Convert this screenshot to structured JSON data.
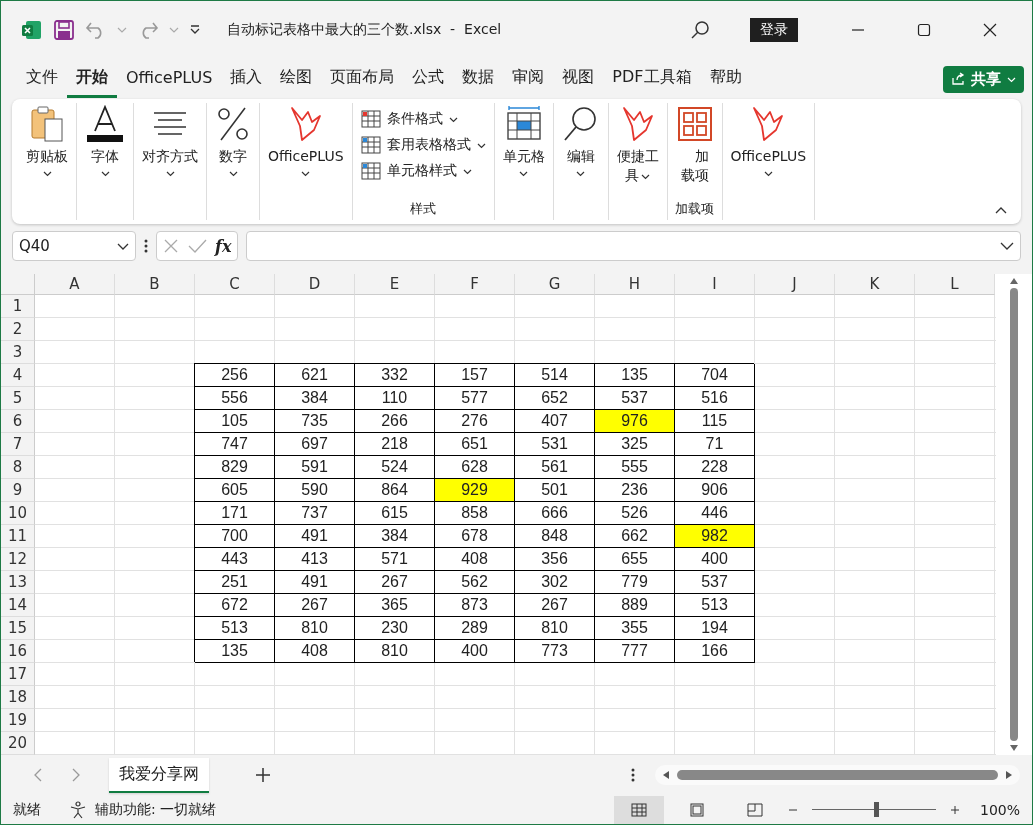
{
  "window": {
    "title": "自动标记表格中最大的三个数.xlsx  -  Excel",
    "sign_in": "登录"
  },
  "menu_tabs": [
    {
      "label": "文件",
      "selected": false
    },
    {
      "label": "开始",
      "selected": true
    },
    {
      "label": "OfficePLUS",
      "selected": false
    },
    {
      "label": "插入",
      "selected": false
    },
    {
      "label": "绘图",
      "selected": false
    },
    {
      "label": "页面布局",
      "selected": false
    },
    {
      "label": "公式",
      "selected": false
    },
    {
      "label": "数据",
      "selected": false
    },
    {
      "label": "审阅",
      "selected": false
    },
    {
      "label": "视图",
      "selected": false
    },
    {
      "label": "PDF工具箱",
      "selected": false
    },
    {
      "label": "帮助",
      "selected": false
    }
  ],
  "share_button": "共享",
  "ribbon": [
    {
      "kind": "large",
      "label": "剪贴板"
    },
    {
      "kind": "large",
      "label": "字体"
    },
    {
      "kind": "large",
      "label": "对齐方式"
    },
    {
      "kind": "large",
      "label": "数字"
    },
    {
      "kind": "large",
      "label": "OfficePLUS"
    },
    {
      "kind": "stack",
      "items": [
        "条件格式",
        "套用表格格式",
        "单元格样式"
      ],
      "group_label": "样式"
    },
    {
      "kind": "large",
      "label": "单元格"
    },
    {
      "kind": "large",
      "label": "编辑"
    },
    {
      "kind": "large",
      "label": "便捷工具"
    },
    {
      "kind": "addin",
      "label": "加载项",
      "group_label": "加载项"
    },
    {
      "kind": "large",
      "label": "OfficePLUS"
    }
  ],
  "formula_bar": {
    "name_box": "Q40",
    "fx": "fx"
  },
  "sheet": {
    "columns": [
      "A",
      "B",
      "C",
      "D",
      "E",
      "F",
      "G",
      "H",
      "I",
      "J",
      "K",
      "L"
    ],
    "rows": [
      {
        "header": "1"
      },
      {
        "header": "2"
      },
      {
        "header": "3"
      },
      {
        "header": "4",
        "values": [
          {
            "text": "256",
            "highlighted": false
          },
          {
            "text": "621",
            "highlighted": false
          },
          {
            "text": "332",
            "highlighted": false
          },
          {
            "text": "157",
            "highlighted": false
          },
          {
            "text": "514",
            "highlighted": false
          },
          {
            "text": "135",
            "highlighted": false
          },
          {
            "text": "704",
            "highlighted": false
          }
        ]
      },
      {
        "header": "5",
        "values": [
          {
            "text": "556",
            "highlighted": false
          },
          {
            "text": "384",
            "highlighted": false
          },
          {
            "text": "110",
            "highlighted": false
          },
          {
            "text": "577",
            "highlighted": false
          },
          {
            "text": "652",
            "highlighted": false
          },
          {
            "text": "537",
            "highlighted": false
          },
          {
            "text": "516",
            "highlighted": false
          }
        ]
      },
      {
        "header": "6",
        "values": [
          {
            "text": "105",
            "highlighted": false
          },
          {
            "text": "735",
            "highlighted": false
          },
          {
            "text": "266",
            "highlighted": false
          },
          {
            "text": "276",
            "highlighted": false
          },
          {
            "text": "407",
            "highlighted": false
          },
          {
            "text": "976",
            "highlighted": true
          },
          {
            "text": "115",
            "highlighted": false
          }
        ]
      },
      {
        "header": "7",
        "values": [
          {
            "text": "747",
            "highlighted": false
          },
          {
            "text": "697",
            "highlighted": false
          },
          {
            "text": "218",
            "highlighted": false
          },
          {
            "text": "651",
            "highlighted": false
          },
          {
            "text": "531",
            "highlighted": false
          },
          {
            "text": "325",
            "highlighted": false
          },
          {
            "text": "71",
            "highlighted": false
          }
        ]
      },
      {
        "header": "8",
        "values": [
          {
            "text": "829",
            "highlighted": false
          },
          {
            "text": "591",
            "highlighted": false
          },
          {
            "text": "524",
            "highlighted": false
          },
          {
            "text": "628",
            "highlighted": false
          },
          {
            "text": "561",
            "highlighted": false
          },
          {
            "text": "555",
            "highlighted": false
          },
          {
            "text": "228",
            "highlighted": false
          }
        ]
      },
      {
        "header": "9",
        "values": [
          {
            "text": "605",
            "highlighted": false
          },
          {
            "text": "590",
            "highlighted": false
          },
          {
            "text": "864",
            "highlighted": false
          },
          {
            "text": "929",
            "highlighted": true
          },
          {
            "text": "501",
            "highlighted": false
          },
          {
            "text": "236",
            "highlighted": false
          },
          {
            "text": "906",
            "highlighted": false
          }
        ]
      },
      {
        "header": "10",
        "values": [
          {
            "text": "171",
            "highlighted": false
          },
          {
            "text": "737",
            "highlighted": false
          },
          {
            "text": "615",
            "highlighted": false
          },
          {
            "text": "858",
            "highlighted": false
          },
          {
            "text": "666",
            "highlighted": false
          },
          {
            "text": "526",
            "highlighted": false
          },
          {
            "text": "446",
            "highlighted": false
          }
        ]
      },
      {
        "header": "11",
        "values": [
          {
            "text": "700",
            "highlighted": false
          },
          {
            "text": "491",
            "highlighted": false
          },
          {
            "text": "384",
            "highlighted": false
          },
          {
            "text": "678",
            "highlighted": false
          },
          {
            "text": "848",
            "highlighted": false
          },
          {
            "text": "662",
            "highlighted": false
          },
          {
            "text": "982",
            "highlighted": true
          }
        ]
      },
      {
        "header": "12",
        "values": [
          {
            "text": "443",
            "highlighted": false
          },
          {
            "text": "413",
            "highlighted": false
          },
          {
            "text": "571",
            "highlighted": false
          },
          {
            "text": "408",
            "highlighted": false
          },
          {
            "text": "356",
            "highlighted": false
          },
          {
            "text": "655",
            "highlighted": false
          },
          {
            "text": "400",
            "highlighted": false
          }
        ]
      },
      {
        "header": "13",
        "values": [
          {
            "text": "251",
            "highlighted": false
          },
          {
            "text": "491",
            "highlighted": false
          },
          {
            "text": "267",
            "highlighted": false
          },
          {
            "text": "562",
            "highlighted": false
          },
          {
            "text": "302",
            "highlighted": false
          },
          {
            "text": "779",
            "highlighted": false
          },
          {
            "text": "537",
            "highlighted": false
          }
        ]
      },
      {
        "header": "14",
        "values": [
          {
            "text": "672",
            "highlighted": false
          },
          {
            "text": "267",
            "highlighted": false
          },
          {
            "text": "365",
            "highlighted": false
          },
          {
            "text": "873",
            "highlighted": false
          },
          {
            "text": "267",
            "highlighted": false
          },
          {
            "text": "889",
            "highlighted": false
          },
          {
            "text": "513",
            "highlighted": false
          }
        ]
      },
      {
        "header": "15",
        "values": [
          {
            "text": "513",
            "highlighted": false
          },
          {
            "text": "810",
            "highlighted": false
          },
          {
            "text": "230",
            "highlighted": false
          },
          {
            "text": "289",
            "highlighted": false
          },
          {
            "text": "810",
            "highlighted": false
          },
          {
            "text": "355",
            "highlighted": false
          },
          {
            "text": "194",
            "highlighted": false
          }
        ]
      },
      {
        "header": "16",
        "values": [
          {
            "text": "135",
            "highlighted": false
          },
          {
            "text": "408",
            "highlighted": false
          },
          {
            "text": "810",
            "highlighted": false
          },
          {
            "text": "400",
            "highlighted": false
          },
          {
            "text": "773",
            "highlighted": false
          },
          {
            "text": "777",
            "highlighted": false
          },
          {
            "text": "166",
            "highlighted": false
          }
        ]
      },
      {
        "header": "17"
      },
      {
        "header": "18"
      },
      {
        "header": "19"
      },
      {
        "header": "20"
      }
    ]
  },
  "sheet_tabs": [
    {
      "label": "我爱分享网",
      "selected": true
    }
  ],
  "status_bar": {
    "ready": "就绪",
    "accessibility": "辅助功能: 一切就绪",
    "views": [
      {
        "selected": true
      },
      {
        "selected": false
      },
      {
        "selected": false
      }
    ],
    "zoom": {
      "level": 0.52,
      "reading": "100%"
    }
  }
}
